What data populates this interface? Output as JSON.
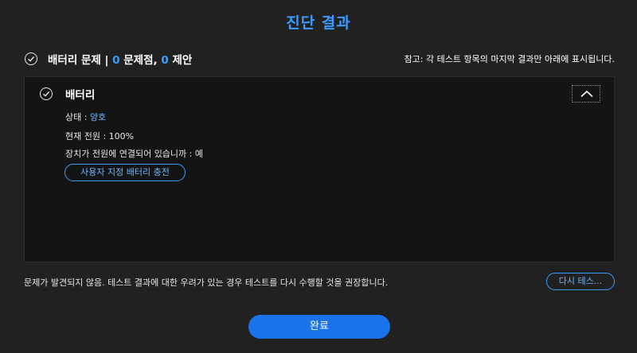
{
  "dialog": {
    "title": "진단 결과"
  },
  "summary": {
    "category": "배터리 문제",
    "separator": " | ",
    "problem_count": "0",
    "problem_label": " 문제점, ",
    "suggestion_count": "0",
    "suggestion_label": " 제안",
    "note": "참고: 각 테스트 항목의 마지막 결과만 아래에 표시됩니다."
  },
  "panel": {
    "header": "배터리",
    "status_label": "상태 : ",
    "status_value": "양호",
    "power_label": "현재 전원 : 100%",
    "connected_label": "장치가 전원에 연결되어 있습니까 : 예",
    "custom_charge_button": "사용자 지정 배터리 충전"
  },
  "footer": {
    "result_message": "문제가 발견되지 않음. 테스트 결과에 대한 우려가 있는 경우 테스트를 다시 수행할 것을 권장합니다.",
    "retest_button": "다시 테스...",
    "done_button": "완료"
  },
  "colors": {
    "accent": "#3d9bff",
    "background": "#212121",
    "panel": "#141414",
    "primary_button": "#1a73e8"
  },
  "icons": {
    "summary_check": "check-circle-icon",
    "panel_check": "check-circle-icon",
    "collapse": "chevron-up-icon"
  }
}
